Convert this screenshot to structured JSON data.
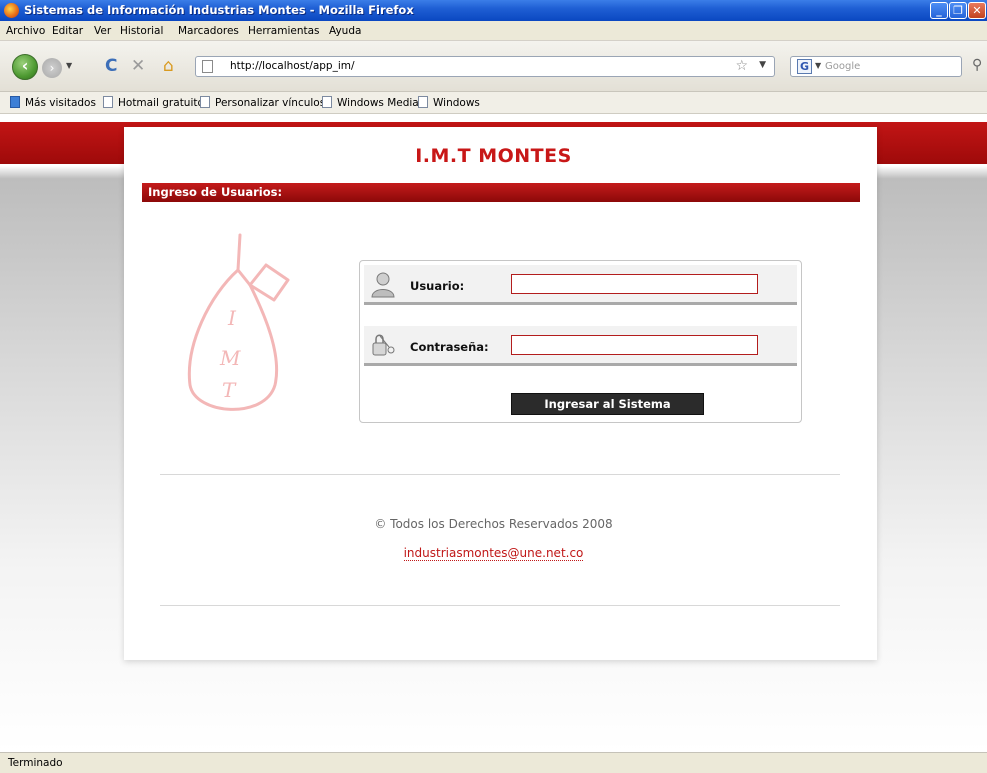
{
  "window": {
    "title": "Sistemas de Información Industrias Montes - Mozilla Firefox"
  },
  "menu": [
    "Archivo",
    "Editar",
    "Ver",
    "Historial",
    "Marcadores",
    "Herramientas",
    "Ayuda"
  ],
  "toolbar": {
    "url": "http://localhost/app_im/",
    "search_placeholder": "Google"
  },
  "bookmarks": [
    "Más visitados",
    "Hotmail gratuito",
    "Personalizar vínculos",
    "Windows Media",
    "Windows"
  ],
  "page": {
    "brand": "I.M.T MONTES",
    "section_title": "Ingreso de Usuarios:",
    "watermark_letters": [
      "I",
      "M",
      "T"
    ],
    "login": {
      "user_label": "Usuario:",
      "user_value": "",
      "password_label": "Contraseña:",
      "password_value": "",
      "submit_label": "Ingresar al Sistema"
    },
    "copyright": "© Todos los Derechos Reservados 2008",
    "email": "industriasmontes@une.net.co"
  },
  "status": "Terminado",
  "colors": {
    "brand_red": "#c81717",
    "titlebar_blue": "#1f5fd4",
    "button_dark": "#2b2b2b"
  }
}
